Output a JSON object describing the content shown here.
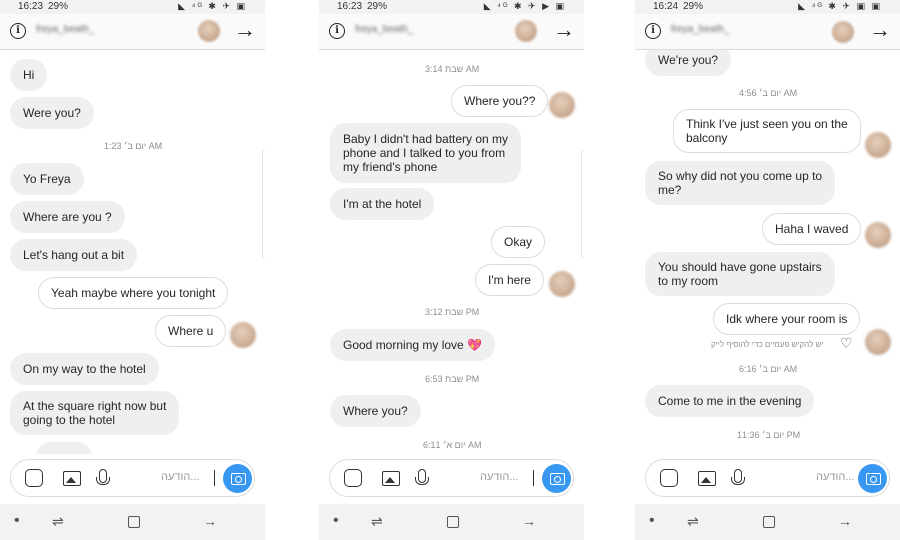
{
  "panels": [
    {
      "status_time": "16:23",
      "status_battery": "29%",
      "status_icons": "◣ ⁴ᴳ ✱ ✈ ▣",
      "header_name": "freya_beath_",
      "composer_placeholder": "הודעה...",
      "messages": [
        {
          "text": "Hi"
        },
        {
          "text": "Were you?"
        },
        {
          "text": "יום ב׳ 1:23 AM"
        },
        {
          "text": "Yo Freya"
        },
        {
          "text": "Where are you ?"
        },
        {
          "text": "Let's hang out a bit"
        },
        {
          "text": "Yeah maybe where you tonight"
        },
        {
          "text": "Where u"
        },
        {
          "text": "On my way to the hotel"
        },
        {
          "text": "At the square right now but\ngoing to the hotel"
        }
      ]
    },
    {
      "status_time": "16:23",
      "status_battery": "29%",
      "status_icons": "◣ ⁴ᴳ ✱ ✈ ▶ ▣",
      "header_name": "freya_beath_",
      "composer_placeholder": "הודעה...",
      "messages": [
        {
          "text": "שבת 3:14 AM"
        },
        {
          "text": "Where you??"
        },
        {
          "text": "Baby I didn't had battery on my\nphone  and I talked to you from\nmy friend's phone"
        },
        {
          "text": "I'm at the hotel"
        },
        {
          "text": "Okay"
        },
        {
          "text": "I'm here"
        },
        {
          "text": "שבת 3:12 PM"
        },
        {
          "text": "Good morning my love 💖"
        },
        {
          "text": "שבת 6:53 PM"
        },
        {
          "text": "Where you?"
        },
        {
          "text": "יום א׳ 6:11 AM"
        }
      ]
    },
    {
      "status_time": "16:24",
      "status_battery": "29%",
      "status_icons": "◣ ⁴ᴳ ✱ ✈ ▣ ▣",
      "header_name": "freya_beath_",
      "composer_placeholder": "הודעה...",
      "hint_text": "יש להקיש פעמיים כדי להוסיף לייק",
      "messages": [
        {
          "text": "We're you?"
        },
        {
          "text": "יום ב׳ 4:56 AM"
        },
        {
          "text": "Think I've just seen you on the\nbalcony"
        },
        {
          "text": "So why did not you come up to\nme?"
        },
        {
          "text": "Haha I waved"
        },
        {
          "text": "You should have gone upstairs\nto my room"
        },
        {
          "text": "Idk where your room is"
        },
        {
          "text": "יום ב׳ 6:16 AM"
        },
        {
          "text": "Come to me in the evening"
        },
        {
          "text": "יום ב׳ 11:36 PM"
        }
      ]
    }
  ],
  "icons": {
    "info": "info-icon",
    "send_arrow": "arrow-right-icon",
    "sticker": "sticker-icon",
    "gallery": "gallery-icon",
    "mic": "microphone-icon",
    "camera": "camera-icon",
    "heart": "heart-icon"
  },
  "colors": {
    "incoming_bubble": "#efefef",
    "outgoing_border": "#dcdcdc",
    "camera_button": "#3897f0",
    "timestamp": "#8e8e8e"
  }
}
